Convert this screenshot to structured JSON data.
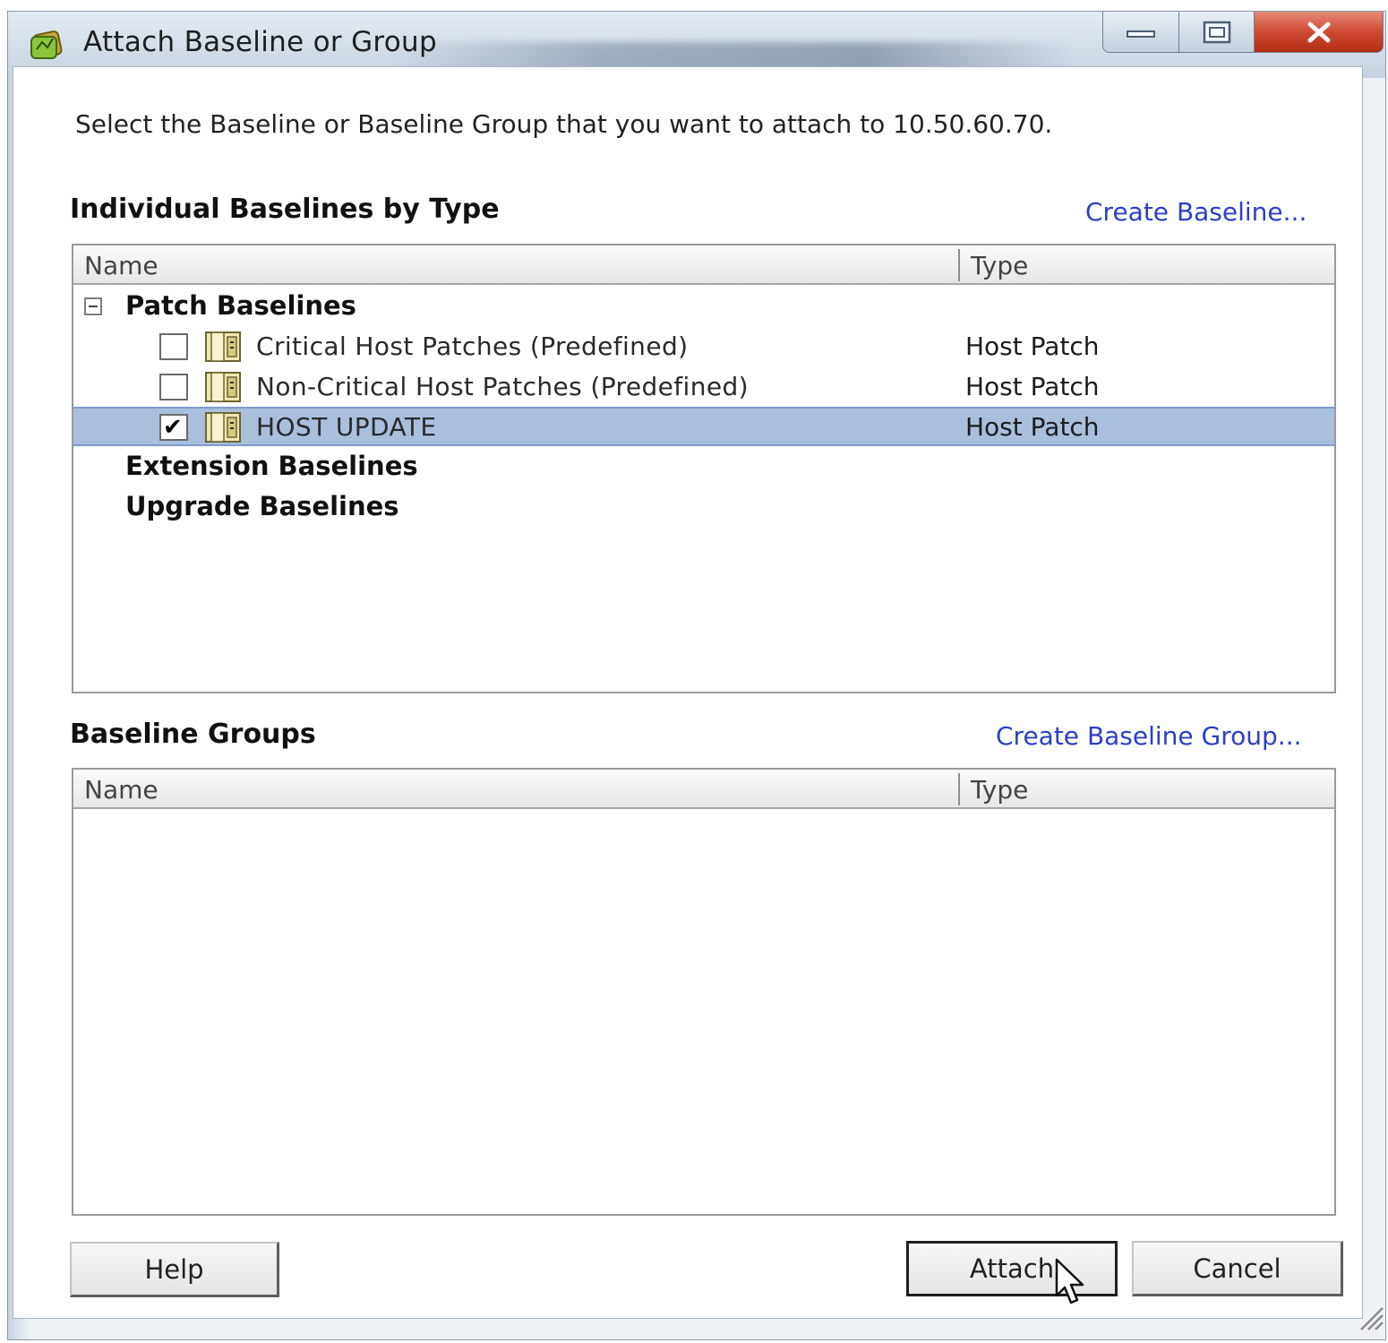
{
  "window": {
    "title": "Attach Baseline or Group"
  },
  "instruction": "Select the Baseline or Baseline Group that you want to attach to 10.50.60.70.",
  "individual": {
    "heading": "Individual Baselines by Type",
    "create_link": "Create Baseline...",
    "columns": [
      "Name",
      "Type"
    ],
    "groups": [
      {
        "label": "Patch Baselines",
        "expanded": true
      },
      {
        "label": "Extension Baselines"
      },
      {
        "label": "Upgrade Baselines"
      }
    ],
    "rows": [
      {
        "name": "Critical Host Patches (Predefined)",
        "type": "Host Patch",
        "checked": false,
        "selected": false
      },
      {
        "name": "Non-Critical Host Patches (Predefined)",
        "type": "Host Patch",
        "checked": false,
        "selected": false
      },
      {
        "name": "HOST UPDATE",
        "type": "Host Patch",
        "checked": true,
        "selected": true
      }
    ]
  },
  "groups_section": {
    "heading": "Baseline Groups",
    "create_link": "Create Baseline Group...",
    "columns": [
      "Name",
      "Type"
    ]
  },
  "buttons": {
    "help": "Help",
    "attach": "Attach",
    "cancel": "Cancel"
  },
  "colors": {
    "link": "#2b3fc7",
    "selection": "#a9bfdc",
    "close_button": "#cf4a32"
  }
}
